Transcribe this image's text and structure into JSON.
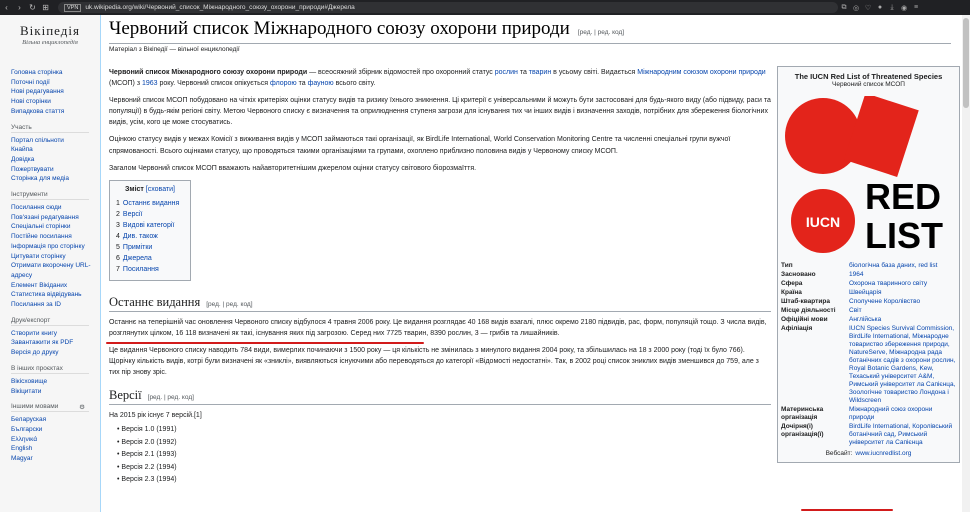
{
  "browser": {
    "url": "uk.wikipedia.org/wiki/Червоний_список_Міжнародного_союзу_охорони_природи#Джерела",
    "vpn": "VPN"
  },
  "logo": {
    "name": "Вікіпедія",
    "tagline": "Вільна енциклопедія"
  },
  "sidebar": {
    "nav": [
      "Головна сторінка",
      "Поточні події",
      "Нові редагування",
      "Нові сторінки",
      "Випадкова стаття"
    ],
    "part_title": "Участь",
    "part": [
      "Портал спільноти",
      "Кнайпа",
      "Довідка",
      "Пожертвувати",
      "Сторінка для медіа"
    ],
    "tools_title": "Інструменти",
    "tools": [
      "Посилання сюди",
      "Пов'язані редагування",
      "Спеціальні сторінки",
      "Постійне посилання",
      "Інформація про сторінку",
      "Цитувати сторінку",
      "Отримати вкорочену URL-адресу",
      "Елемент Вікіданих",
      "Статистика відвідувань",
      "Посилання за ID"
    ],
    "print_title": "Друк/експорт",
    "print": [
      "Створити книгу",
      "Завантажити як PDF",
      "Версія до друку"
    ],
    "other_title": "В інших проєктах",
    "other": [
      "Вікісховище",
      "Вікіцитати"
    ],
    "lang_title": "Іншими мовами",
    "langs": [
      "Беларуская",
      "Български",
      "Ελληνικά",
      "English",
      "Magyar"
    ]
  },
  "page": {
    "title": "Червоний список Міжнародного союзу охорони природи",
    "edit": "[ред. | ред. код]",
    "from": "Матеріал з Вікіпедії — вільної енциклопедії"
  },
  "intro": {
    "p1_bold": "Червоний список Міжнародного союзу охорони природи",
    "p1_a": " — всеосяжний збірник відомостей про охоронний статус ",
    "p1_l1": "рослин",
    "p1_b": " та ",
    "p1_l2": "тварин",
    "p1_c": " в усьому світі. Видається ",
    "p1_l3": "Міжнародним союзом охорони природи",
    "p1_d": " (МСОП) з ",
    "p1_l4": "1963",
    "p1_e": " року. Червоний список опікується ",
    "p1_l5": "флорою",
    "p1_f": " та ",
    "p1_l6": "фауною",
    "p1_g": " всього світу.",
    "p2": "Червоний список МСОП побудовано на чіткіх критеріях оцінки статусу видів та ризику їхнього зникнення. Ці критерії є універсальними й можуть бути застосовані для будь-якого виду (або підвиду, раси та популяції) в будь-якім регіоні світу. Метою Червоного списку є визначення та оприлюднення ступеня загрози для існування тих чи інших видів і визначення заходів, потрібних для збереження біологічних видів, усім, кого це може стосуватись.",
    "p3": "Оцінкою статусу видів у межах Комісії з виживання видів у МСОП займаються такі організації, як BirdLife International, World Conservation Monitoring Centre та численні спеціальні групи вужчої спрямованості. Всього оцінками статусу, що проводяться такими організаціями та групами, охоплено приблизно половина видів у Червоному списку МСОП.",
    "p4": "Загалом Червоний список МСОП вважають найавторитетнішим джерелом оцінки статусу світового біорозмаїття."
  },
  "toc": {
    "title": "Зміст",
    "hide": "[сховати]",
    "items": [
      {
        "n": "1",
        "label": "Останнє видання"
      },
      {
        "n": "2",
        "label": "Версії"
      },
      {
        "n": "3",
        "label": "Видові категорії"
      },
      {
        "n": "4",
        "label": "Див. також"
      },
      {
        "n": "5",
        "label": "Примітки"
      },
      {
        "n": "6",
        "label": "Джерела"
      },
      {
        "n": "7",
        "label": "Посилання"
      }
    ]
  },
  "sec1": {
    "title": "Останнє видання",
    "edit": "[ред. | ред. код]",
    "p1": "Останнє на теперішній час оновлення Червоного списку відбулося 4 травня 2006 року. Це видання розглядає 40 168 видів взагалі, плюс окремо 2180 підвидів, рас, форм, популяцій тощо. З числа видів, розглянутих цілком, 16 118 визначені як такі, існування яких під загрозою. Серед них 7725 тварин, 8390 рослин, 3 — грибів та лишайників.",
    "p2": "Це видання Червоного списку наводить 784 види, вимерлих починаючи з 1500 року — ця кількість не змінилась з минулого видання 2004 року, та збільшилась на 18 з 2000 року (тоді їх було 766). Щорічку кількість видів, котрі були визначені як «зниклі», виявляються існуючими або переводяться до категорії «Відомості недостатні». Так, в 2002 році список зниклих видів зменшився до 759, але з тих пір знову зріс."
  },
  "sec2": {
    "title": "Версії",
    "edit": "[ред. | ред. код]",
    "intro": "На 2015 рік існує 7 версій.[1]",
    "versions": [
      "Версія 1.0 (1991)",
      "Версія 2.0 (1992)",
      "Версія 2.1 (1993)",
      "Версія 2.2 (1994)",
      "Версія 2.3 (1994)"
    ]
  },
  "infobox": {
    "title": "The IUCN Red List of Threatened Species",
    "subtitle": "Червоний список МСОП",
    "logo_text": [
      "RED",
      "LIST"
    ],
    "logo_badge": "IUCN",
    "rows": [
      {
        "k": "Тип",
        "v": "біологічна база даних, red list"
      },
      {
        "k": "Засновано",
        "v": "1964"
      },
      {
        "k": "Сфера",
        "v": "Охорона тваринного світу"
      },
      {
        "k": "Країна",
        "v": "Швейцарія"
      },
      {
        "k": "Штаб-квартира",
        "v": "Сполучене Королівство"
      },
      {
        "k": "Місце діяльності",
        "v": "Світ"
      },
      {
        "k": "Офіційні мови",
        "v": "Англійська"
      },
      {
        "k": "Афіліація",
        "v": "IUCN Species Survival Commission, BirdLife International, Міжнародне товариство збереження природи, NatureServe, Міжнародна рада ботанічних садів з охорони рослин, Royal Botanic Gardens, Kew, Техаський університет A&M, Римський університет ла Сапієнца, Зоологічне товариство Лондона і Wildscreen"
      },
      {
        "k": "Материнська організація",
        "v": "Міжнародний союз охорони природи"
      },
      {
        "k": "Дочірня(і) організація(ї)",
        "v": "BirdLife International, Королівський ботанічний сад, Римський університет ла Сапієнца"
      }
    ],
    "website_label": "Вебсайт:",
    "website": "www.iucnredlist.org"
  },
  "colors": {
    "link": "#0645ad",
    "red_mark": "#d21b1b",
    "logo_red": "#e3241b"
  }
}
